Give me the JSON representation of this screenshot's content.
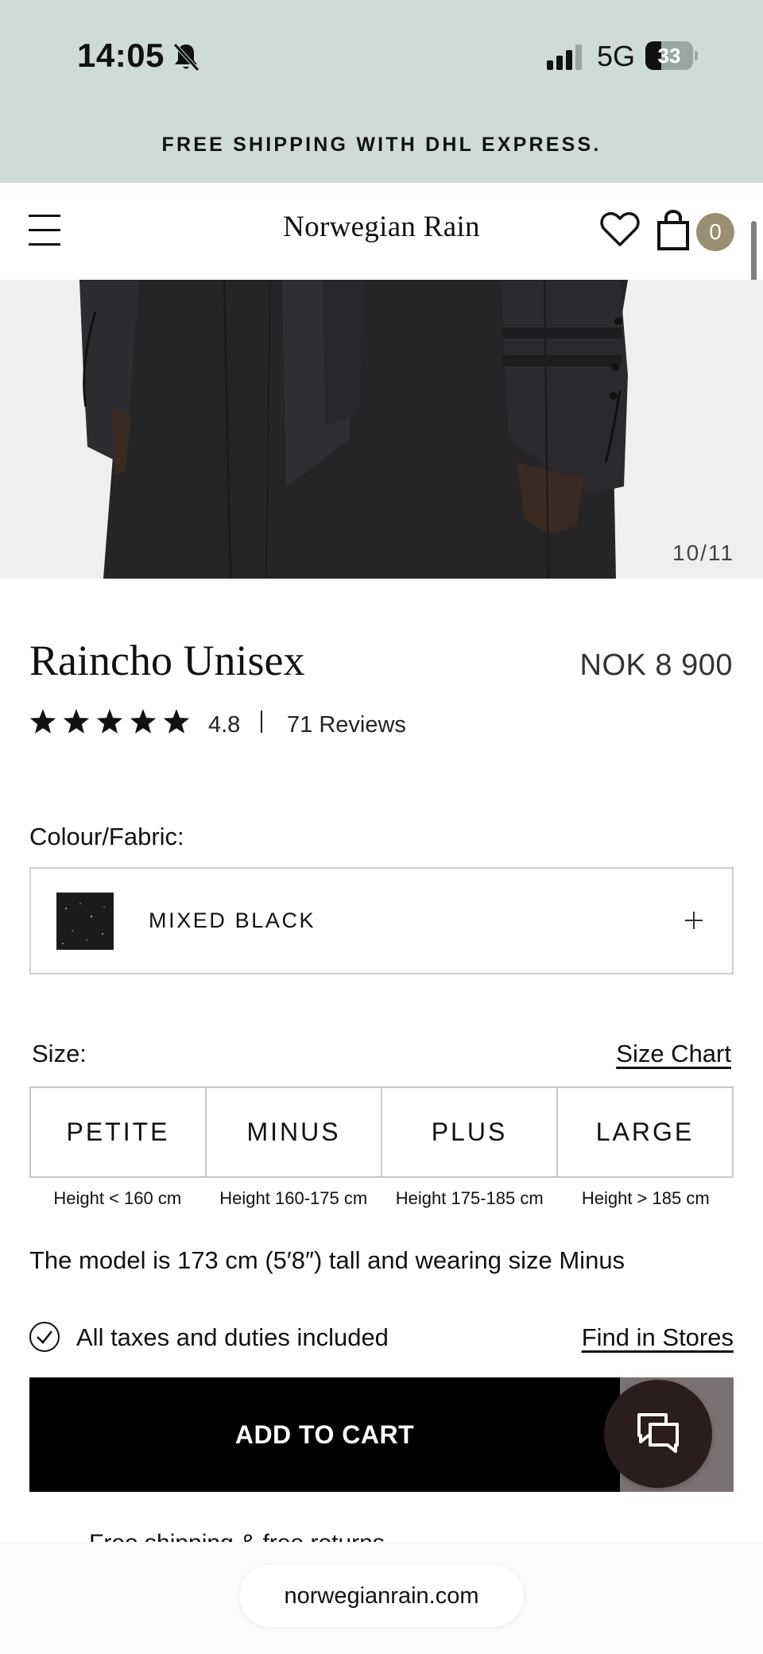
{
  "status_bar": {
    "time": "14:05",
    "network": "5G",
    "battery_percent": "33",
    "battery_level": 0.33
  },
  "promo_banner": {
    "text": "FREE SHIPPING WITH DHL EXPRESS."
  },
  "header": {
    "logo": "Norwegian Rain",
    "cart_count": "0"
  },
  "gallery": {
    "counter": "10/11"
  },
  "product": {
    "title": "Raincho Unisex",
    "price": "NOK 8 900",
    "rating": {
      "stars": 5,
      "value": "4.8",
      "reviews_label": "71 Reviews"
    }
  },
  "colour": {
    "label": "Colour/Fabric:",
    "selected": "MIXED BLACK"
  },
  "size": {
    "label": "Size:",
    "chart_link": "Size Chart",
    "options": [
      {
        "label": "PETITE",
        "height": "Height < 160 cm"
      },
      {
        "label": "MINUS",
        "height": "Height 160-175 cm"
      },
      {
        "label": "PLUS",
        "height": "Height 175-185 cm"
      },
      {
        "label": "LARGE",
        "height": "Height > 185 cm"
      }
    ]
  },
  "model_info": "The model is 173 cm (5′8″) tall and wearing size Minus",
  "taxes": {
    "text": "All taxes and duties included",
    "stores_link": "Find in Stores"
  },
  "cta": {
    "add_to_cart": "ADD TO CART"
  },
  "footer_note": "Free shipping & free returns",
  "browser": {
    "url": "norwegianrain.com"
  },
  "icons": {
    "menu": "hamburger-menu-icon",
    "wishlist": "heart-icon",
    "cart": "shopping-bag-icon",
    "chat": "chat-bubbles-icon",
    "taxes": "check-circle-icon",
    "expand": "plus-icon",
    "notifications": "bell-slash-icon"
  },
  "colors": {
    "banner_bg": "#cfdcd6",
    "cart_badge": "#9a8f72",
    "button_bg": "#000000",
    "chat_bg": "#2b1d1d"
  }
}
